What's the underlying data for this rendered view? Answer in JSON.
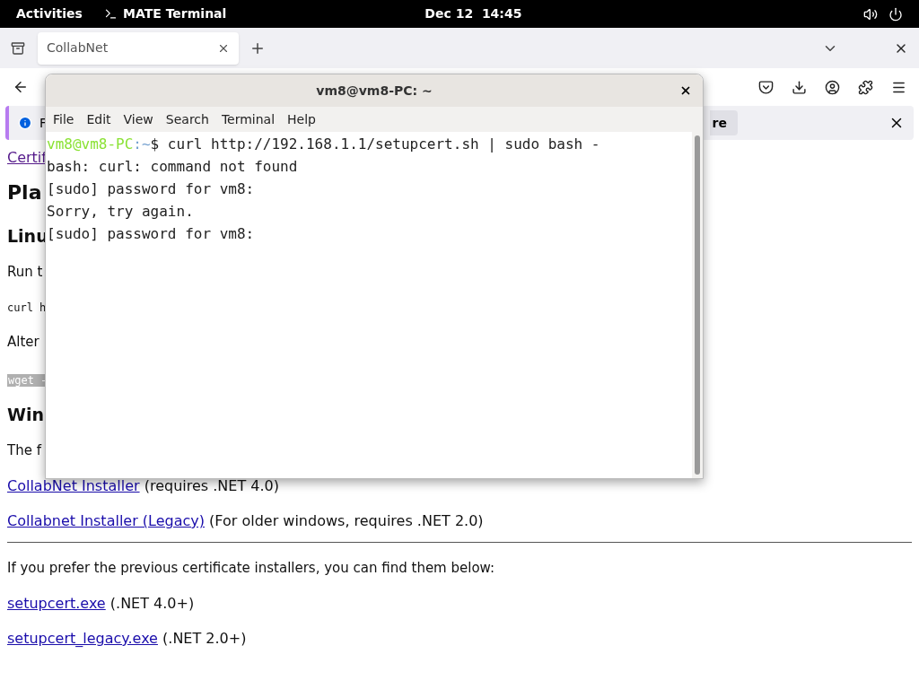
{
  "top_bar": {
    "activities": "Activities",
    "app_name": "MATE Terminal",
    "clock": "Dec 12  14:45"
  },
  "browser": {
    "tab": {
      "title": "CollabNet",
      "selected": true
    },
    "notification": {
      "text": "F",
      "button": "re"
    },
    "page": [
      {
        "kind": "link",
        "text": "Certif"
      },
      {
        "kind": "h1",
        "text": "Pla"
      },
      {
        "kind": "h2",
        "text": "Linu"
      },
      {
        "kind": "p",
        "text": "Run t"
      },
      {
        "kind": "code",
        "text": "curl h"
      },
      {
        "kind": "p",
        "text": "Alter"
      },
      {
        "kind": "highlight",
        "text": "wget -"
      },
      {
        "kind": "h2",
        "text": "Win"
      },
      {
        "kind": "p",
        "text": "The f"
      },
      {
        "kind": "linkline",
        "link": "CollabNet Installer",
        "text": "(requires .NET 4.0)"
      },
      {
        "kind": "linkline",
        "link": "Collabnet Installer (Legacy)",
        "text": "(For older windows, requires .NET 2.0)"
      },
      {
        "kind": "rule"
      },
      {
        "kind": "p",
        "text": "If you prefer the previous certificate installers, you can find them below:"
      },
      {
        "kind": "linkline",
        "link": "setupcert.exe",
        "text": "(.NET 4.0+)"
      },
      {
        "kind": "linkline",
        "link": "setupcert_legacy.exe",
        "text": "(.NET 2.0+)"
      }
    ]
  },
  "terminal": {
    "title": "vm8@vm8-PC: ~",
    "menu": [
      "File",
      "Edit",
      "View",
      "Search",
      "Terminal",
      "Help"
    ],
    "lines": [
      {
        "kind": "prompt",
        "user": "vm8@vm8-PC",
        "path": ":~",
        "command": "$ curl http://192.168.1.1/setupcert.sh | sudo bash -"
      },
      {
        "kind": "output",
        "text": "bash: curl: command not found"
      },
      {
        "kind": "output",
        "text": "[sudo] password for vm8:"
      },
      {
        "kind": "output",
        "text": "Sorry, try again."
      },
      {
        "kind": "output",
        "text": "[sudo] password for vm8:"
      }
    ]
  }
}
